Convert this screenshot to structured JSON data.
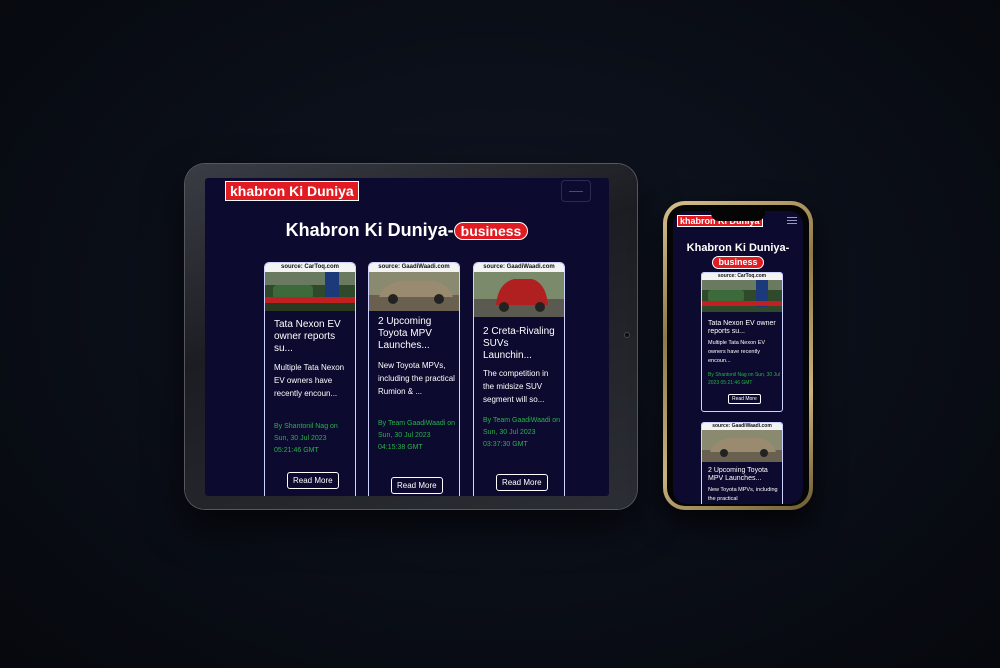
{
  "site": {
    "logo": "khabron Ki Duniya",
    "title_prefix": "Khabron Ki Duniya-",
    "category": "business",
    "accent_color": "#e11b22",
    "background_color": "#0c0a2e"
  },
  "cards": [
    {
      "source": "source: CarToq.com",
      "headline": "Tata Nexon EV owner reports su...",
      "description": "Multiple Tata Nexon EV owners have recently encoun...",
      "meta": "By Shantonil Nag on Sun, 30 Jul 2023 05:21:46 GMT",
      "button": "Read More"
    },
    {
      "source": "source: GaadiWaadi.com",
      "headline": "2 Upcoming Toyota MPV Launches...",
      "description": "New Toyota MPVs, including the practical Rumion & ...",
      "meta": "By Team GaadiWaadi on Sun, 30 Jul 2023 04:15:38 GMT",
      "button": "Read More"
    },
    {
      "source": "source: GaadiWaadi.com",
      "headline": "2 Creta-Rivaling SUVs Launchin...",
      "description": "The competition in the midsize SUV segment will so...",
      "meta": "By Team GaadiWaadi on Sun, 30 Jul 2023 03:37:30 GMT",
      "button": "Read More"
    }
  ],
  "phone": {
    "card1_meta": "By Shantonil Nag on Sun, 30 Jul 2023 05:21:46 GMT",
    "card2_description": "New Toyota MPVs, including the practical"
  },
  "icons": [
    "menu-icon"
  ]
}
